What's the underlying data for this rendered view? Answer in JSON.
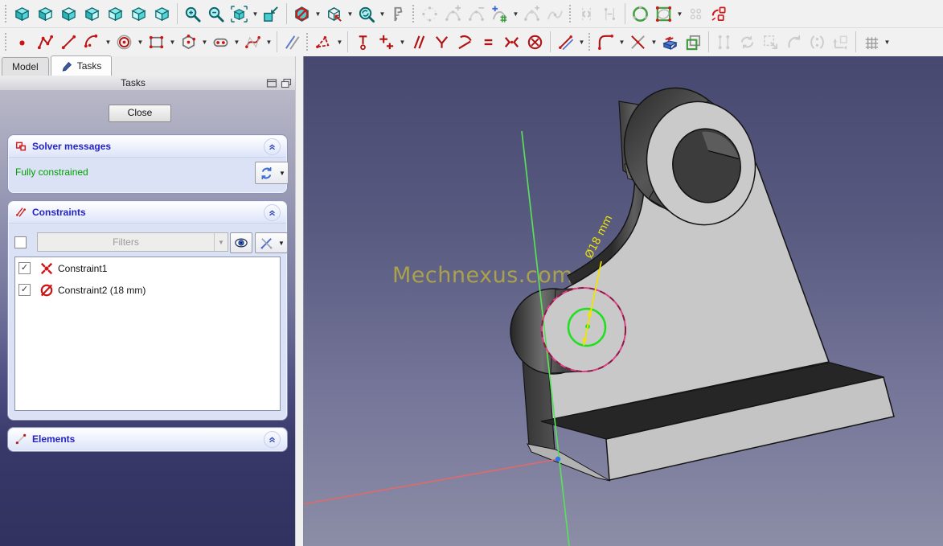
{
  "toolbar": {
    "row1": [
      {
        "sep": "grip",
        "icons": [
          {
            "n": "view-axonometric"
          },
          {
            "n": "view-front"
          },
          {
            "n": "view-top"
          },
          {
            "n": "view-right"
          },
          {
            "n": "view-rear"
          },
          {
            "n": "view-bottom"
          },
          {
            "n": "view-left"
          }
        ]
      },
      {
        "sep": "line",
        "icons": [
          {
            "n": "zoom-in"
          },
          {
            "n": "zoom-out"
          },
          {
            "n": "zoom-fit-all",
            "dd": true
          },
          {
            "n": "zoom-selection"
          }
        ]
      },
      {
        "sep": "line",
        "icons": [
          {
            "n": "clipping-plane",
            "dd": true
          },
          {
            "n": "view-sketch-normal",
            "dd": true
          },
          {
            "n": "zoom-sync",
            "dd": true
          },
          {
            "n": "measure-distance"
          }
        ]
      },
      {
        "sep": "grip",
        "icons": [
          {
            "n": "bspline-comb",
            "dis": true
          },
          {
            "n": "bspline-degree-increase",
            "dis": true
          },
          {
            "n": "bspline-degree-decrease",
            "dis": true
          },
          {
            "n": "bspline-knot-multiplicity",
            "dd": true
          },
          {
            "n": "bspline-insert-knot",
            "dis": true
          },
          {
            "n": "bspline-join",
            "dis": true
          }
        ]
      },
      {
        "sep": "grip",
        "icons": [
          {
            "n": "mirror-elements",
            "dis": true
          },
          {
            "n": "symmetry-line",
            "dis": true
          }
        ]
      },
      {
        "sep": "line",
        "icons": [
          {
            "n": "bspline-periodic"
          },
          {
            "n": "bspline-control-polygon",
            "dd": true
          },
          {
            "n": "clone-offset",
            "dis": true
          },
          {
            "n": "activate-constraint"
          }
        ]
      }
    ],
    "row2": [
      {
        "sep": "grip",
        "icons": [
          {
            "n": "create-point"
          },
          {
            "n": "create-polyline"
          },
          {
            "n": "create-line"
          },
          {
            "n": "create-arc",
            "dd": true
          },
          {
            "n": "create-circle",
            "dd": true
          },
          {
            "n": "create-rectangle",
            "dd": true
          },
          {
            "n": "create-polygon",
            "dd": true
          },
          {
            "n": "create-slot",
            "dd": true
          },
          {
            "n": "create-bspline",
            "dd": true
          }
        ]
      },
      {
        "sep": "line",
        "icons": [
          {
            "n": "split-edge"
          }
        ]
      },
      {
        "sep": "grip",
        "icons": [
          {
            "n": "construction-mode",
            "dd": true
          }
        ]
      },
      {
        "sep": "line",
        "icons": [
          {
            "n": "constrain-vertical-distance"
          },
          {
            "n": "constrain-lock",
            "dd": true
          },
          {
            "n": "constrain-parallel"
          },
          {
            "n": "constrain-perpendicular"
          },
          {
            "n": "constrain-tangent"
          },
          {
            "n": "constrain-equal"
          },
          {
            "n": "constrain-symmetric"
          },
          {
            "n": "constrain-block"
          }
        ]
      },
      {
        "sep": "line",
        "icons": [
          {
            "n": "constrain-distance",
            "dd": true
          }
        ]
      },
      {
        "sep": "grip",
        "icons": [
          {
            "n": "fillet",
            "dd": true
          },
          {
            "n": "trim-edge",
            "dd": true
          },
          {
            "n": "external-geometry"
          },
          {
            "n": "carbon-copy"
          }
        ]
      },
      {
        "sep": "line",
        "icons": [
          {
            "n": "select-constrained-elements",
            "dis": true
          },
          {
            "n": "select-redundant-constraints",
            "dis": true
          },
          {
            "n": "select-conflicting-constraints",
            "dis": true
          },
          {
            "n": "select-associated-constraints",
            "dis": true
          },
          {
            "n": "show-internal-geometry",
            "dis": true
          },
          {
            "n": "switch-virtual-space",
            "dis": true
          }
        ]
      },
      {
        "sep": "line",
        "icons": [
          {
            "n": "toggle-grid",
            "dd": true
          }
        ]
      }
    ]
  },
  "panel": {
    "tabs": [
      {
        "label": "Model",
        "active": false
      },
      {
        "label": "Tasks",
        "active": true,
        "icon": "pencil-icon"
      }
    ],
    "title": "Tasks",
    "close_button": "Close",
    "solver": {
      "title": "Solver messages",
      "status": "Fully constrained",
      "status_color": "#00a000"
    },
    "constraints": {
      "title": "Constraints",
      "filter_placeholder": "Filters",
      "items": [
        {
          "label": "Constraint1",
          "icon": "coincident-constraint-icon",
          "checked": true
        },
        {
          "label": "Constraint2 (18 mm)",
          "icon": "diameter-constraint-icon",
          "checked": true
        }
      ]
    },
    "elements": {
      "title": "Elements"
    }
  },
  "viewport": {
    "watermark": "Mechnexus.com",
    "dimension_label": "Ø18 mm",
    "colors": {
      "bg_top": "#474870",
      "bg_bottom": "#8c8da6",
      "part_light": "#c8c8c8",
      "part_dark": "#3a3a3a",
      "sketch_green": "#1ee01e",
      "dimension_yellow": "#f0e400",
      "axis_red": "#e06a6a",
      "axis_green": "#58e058",
      "origin_blue": "#2f76e8",
      "highlight_edge": "#e0408c",
      "watermark_color": "#b1a748"
    }
  }
}
